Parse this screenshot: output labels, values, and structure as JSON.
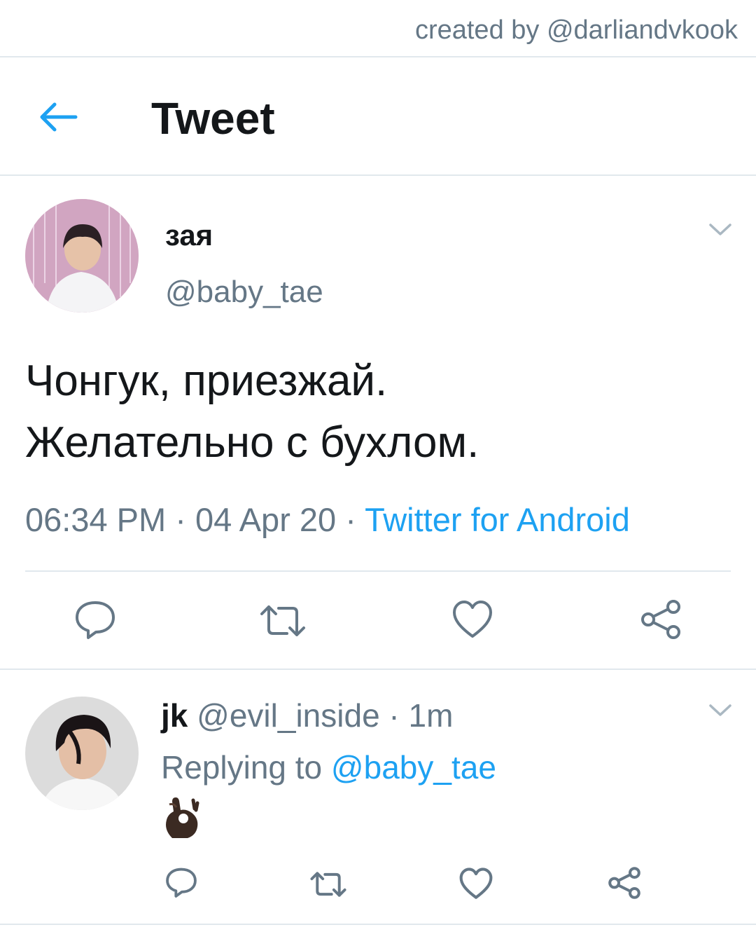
{
  "watermark": "created by @darliandvkook",
  "header": {
    "title": "Tweet"
  },
  "tweet": {
    "author_name": "зая",
    "author_handle": "@baby_tae",
    "text_line1": "Чонгук, приезжай.",
    "text_line2": "Желательно с бухлом.",
    "time": "06:34 PM",
    "sep1": " · ",
    "date": "04 Apr 20",
    "sep2": " · ",
    "source": "Twitter for Android"
  },
  "reply": {
    "author_name": "jk",
    "author_handle": "@evil_inside",
    "sep": " · ",
    "time_ago": "1m",
    "replying_prefix": "Replying to ",
    "replying_handle": "@baby_tae",
    "body_emoji": "ok-hand-dark-skin"
  },
  "colors": {
    "accent": "#1da1f2",
    "secondary_text": "#657786",
    "divider": "#e1e8ed"
  }
}
